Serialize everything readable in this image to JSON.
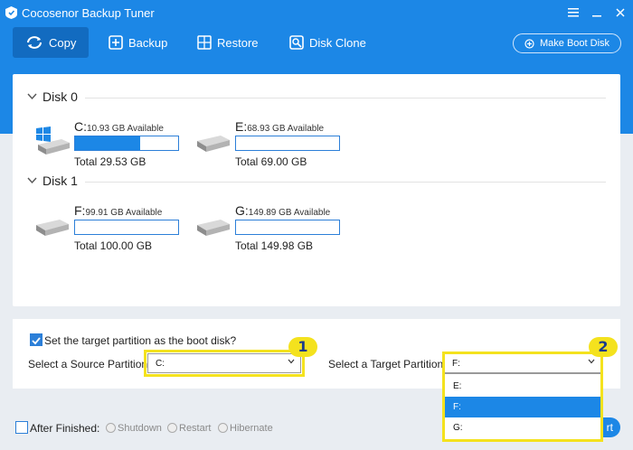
{
  "app": {
    "title": "Cocosenor Backup Tuner"
  },
  "toolbar": {
    "copy": "Copy",
    "backup": "Backup",
    "restore": "Restore",
    "disk_clone": "Disk Clone",
    "make_boot_disk": "Make Boot Disk"
  },
  "disks": [
    {
      "name": "Disk 0",
      "partitions": [
        {
          "letter": "C:",
          "available": "10.93 GB Available",
          "total": "Total 29.53 GB",
          "used_fraction": 0.63,
          "windows": true
        },
        {
          "letter": "E:",
          "available": "68.93 GB Available",
          "total": "Total 69.00 GB",
          "used_fraction": 0.0,
          "windows": false
        }
      ]
    },
    {
      "name": "Disk 1",
      "partitions": [
        {
          "letter": "F:",
          "available": "99.91 GB Available",
          "total": "Total 100.00 GB",
          "used_fraction": 0.0,
          "windows": false
        },
        {
          "letter": "G:",
          "available": "149.89 GB Available",
          "total": "Total 149.98 GB",
          "used_fraction": 0.0,
          "windows": false
        }
      ]
    }
  ],
  "options": {
    "boot_checkbox_label": "Set the target partition as the boot disk?",
    "boot_checked": true,
    "source_label": "Select a Source Partition:",
    "source_value": "C:",
    "target_label": "Select a Target Partition:",
    "target_value": "F:",
    "target_options": [
      "E:",
      "F:",
      "G:"
    ],
    "target_selected": "F:"
  },
  "badges": {
    "one": "1",
    "two": "2"
  },
  "footer": {
    "after_finished": "After Finished:",
    "shutdown": "Shutdown",
    "restart": "Restart",
    "hibernate": "Hibernate",
    "start_partial": "rt"
  },
  "colors": {
    "brand": "#1c87e6",
    "highlight": "#f4e21e"
  }
}
